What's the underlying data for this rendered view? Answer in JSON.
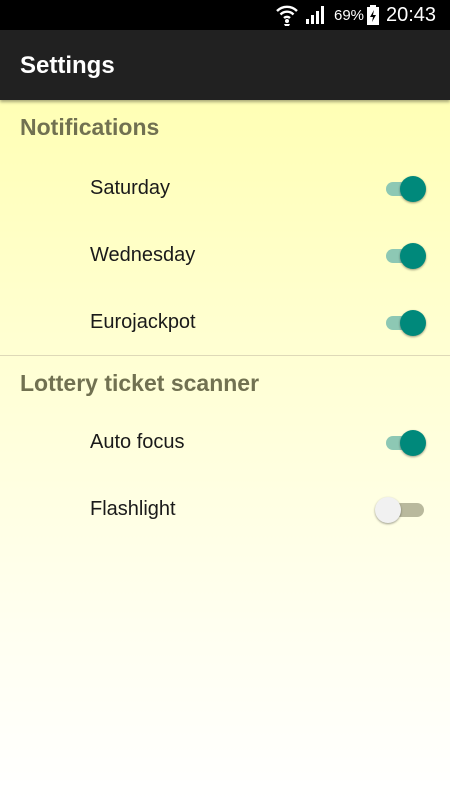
{
  "status_bar": {
    "battery_percent": "69%",
    "time": "20:43",
    "icons": [
      "wifi-icon",
      "signal-icon",
      "battery-charging-icon"
    ]
  },
  "app_bar": {
    "title": "Settings"
  },
  "sections": [
    {
      "header": "Notifications",
      "items": [
        {
          "label": "Saturday",
          "enabled": true
        },
        {
          "label": "Wednesday",
          "enabled": true
        },
        {
          "label": "Eurojackpot",
          "enabled": true
        }
      ]
    },
    {
      "header": "Lottery ticket scanner",
      "items": [
        {
          "label": "Auto focus",
          "enabled": true
        },
        {
          "label": "Flashlight",
          "enabled": false
        }
      ]
    }
  ],
  "colors": {
    "app_bar": "#212121",
    "accent": "#00897b",
    "section_header": "#717151",
    "background_top": "#ffffb5"
  }
}
